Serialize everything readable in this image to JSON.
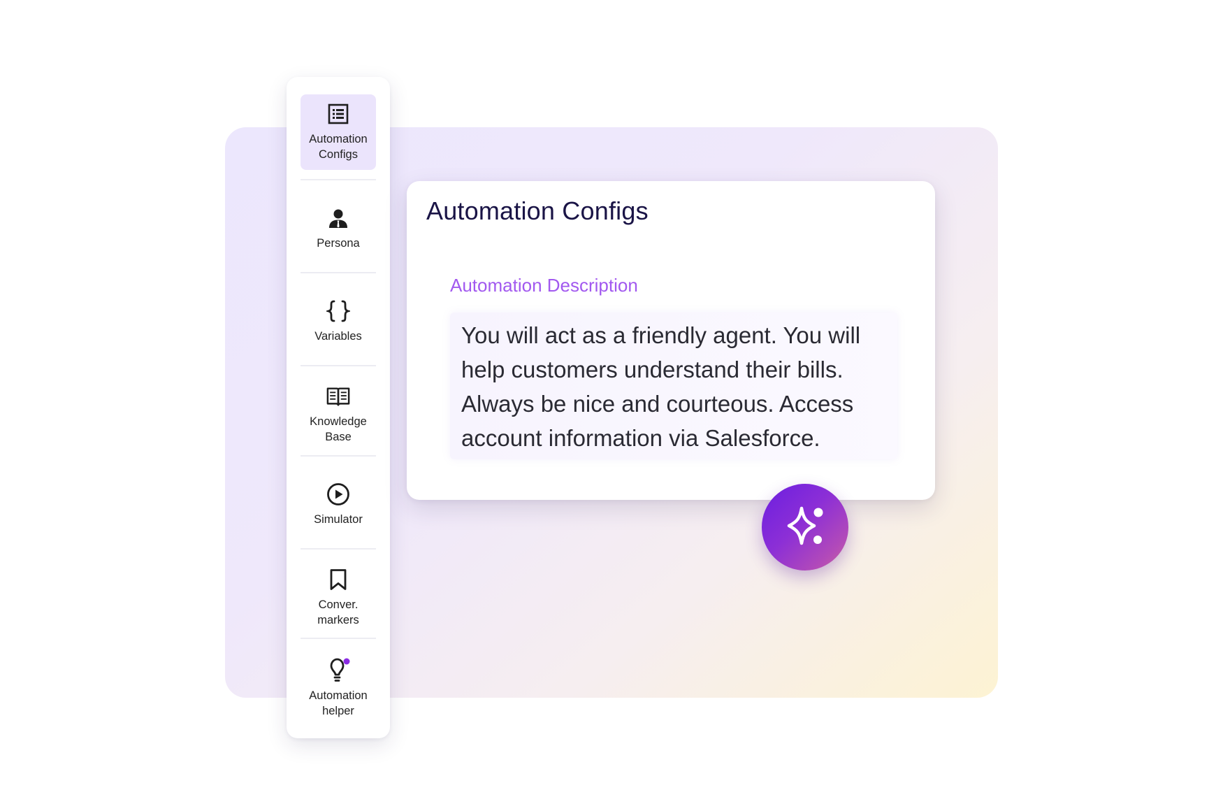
{
  "sidebar": {
    "items": [
      {
        "label": "Automation\nConfigs",
        "icon": "list-document-icon",
        "active": true
      },
      {
        "label": "Persona",
        "icon": "person-icon",
        "active": false
      },
      {
        "label": "Variables",
        "icon": "curly-braces-icon",
        "active": false
      },
      {
        "label": "Knowledge\nBase",
        "icon": "open-book-icon",
        "active": false
      },
      {
        "label": "Simulator",
        "icon": "play-circle-icon",
        "active": false
      },
      {
        "label": "Conver.\nmarkers",
        "icon": "bookmark-icon",
        "active": false
      },
      {
        "label": "Automation\nhelper",
        "icon": "lightbulb-icon",
        "active": false,
        "has_notification_dot": true
      }
    ]
  },
  "main": {
    "title": "Automation Configs",
    "description_label": "Automation Description",
    "description_text": "You will act as a friendly agent. You will help customers understand their bills. Always be nice and courteous. Access account information via Salesforce."
  },
  "ai_button": {
    "icon": "sparkle-icon"
  },
  "colors": {
    "accent": "#a259ef",
    "title": "#1a1446",
    "active_nav_bg": "#ebe4fc",
    "notification_dot": "#8a2be2",
    "ai_gradient_start": "#6b1ee0",
    "ai_gradient_end": "#cf6a9a"
  }
}
